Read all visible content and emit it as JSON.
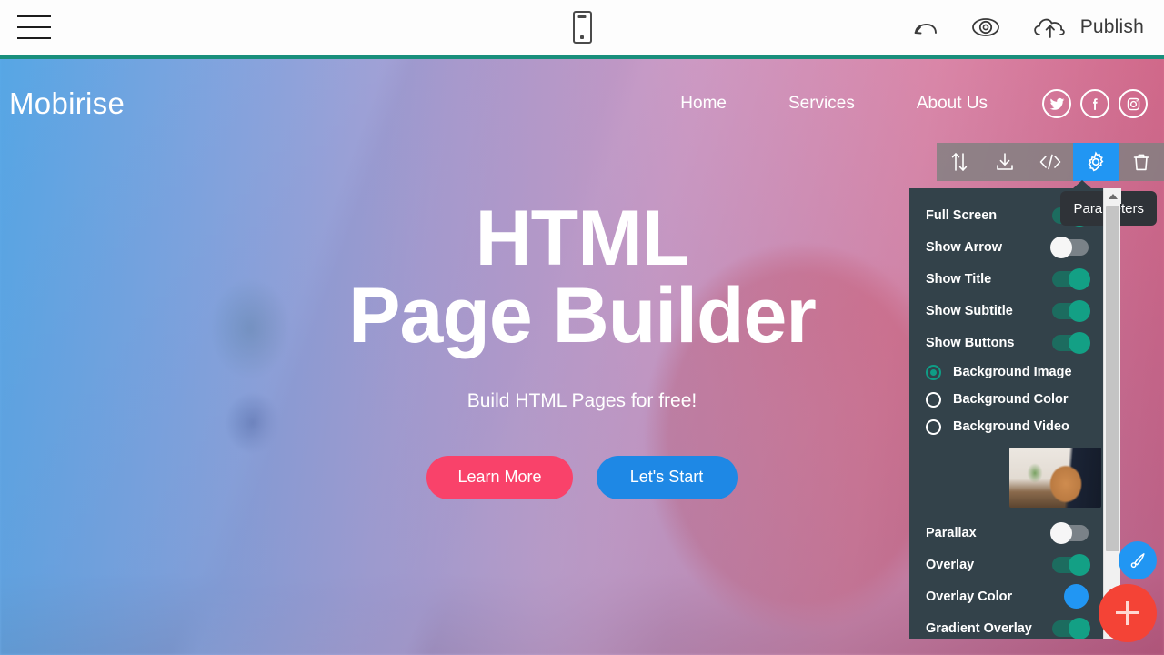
{
  "app_toolbar": {
    "menu_icon": "hamburger-menu-icon",
    "device_icon": "mobile-device-icon",
    "undo_icon": "undo-arrow-icon",
    "preview_icon": "eye-preview-icon",
    "publish_icon": "cloud-upload-icon",
    "publish_label": "Publish"
  },
  "site": {
    "brand": "Mobirise",
    "nav_links": [
      {
        "label": "Home"
      },
      {
        "label": "Services"
      },
      {
        "label": "About Us"
      }
    ],
    "social": [
      {
        "name": "twitter-icon"
      },
      {
        "name": "facebook-icon"
      },
      {
        "name": "instagram-icon"
      }
    ]
  },
  "hero": {
    "title_line1": "HTML",
    "title_line2": "Page Builder",
    "subtitle": "Build HTML Pages for free!",
    "buttons": [
      {
        "label": "Learn More",
        "color": "#f9426a"
      },
      {
        "label": "Let's Start",
        "color": "#1e88e5"
      }
    ]
  },
  "block_toolbar": {
    "items": [
      {
        "name": "move-block-icon",
        "active": false
      },
      {
        "name": "download-icon",
        "active": false
      },
      {
        "name": "code-editor-icon",
        "active": false
      },
      {
        "name": "gear-settings-icon",
        "active": true
      },
      {
        "name": "trash-delete-icon",
        "active": false
      }
    ],
    "active_color": "#2196f3"
  },
  "tooltip": {
    "text": "Parameters"
  },
  "settings_panel": {
    "toggles": [
      {
        "label": "Full Screen",
        "on": true
      },
      {
        "label": "Show Arrow",
        "on": false
      },
      {
        "label": "Show Title",
        "on": true
      },
      {
        "label": "Show Subtitle",
        "on": true
      },
      {
        "label": "Show Buttons",
        "on": true
      }
    ],
    "background_options": [
      {
        "label": "Background Image",
        "selected": true
      },
      {
        "label": "Background Color",
        "selected": false
      },
      {
        "label": "Background Video",
        "selected": false
      }
    ],
    "thumbnail_name": "background-image-thumbnail",
    "bottom_toggles": [
      {
        "label": "Parallax",
        "on": false
      },
      {
        "label": "Overlay",
        "on": true
      }
    ],
    "overlay_color_label": "Overlay Color",
    "overlay_color": "#2196f3",
    "gradient_overlay": {
      "label": "Gradient Overlay",
      "on": true
    },
    "toggle_on_color": "#13a085",
    "toggle_off_color": "#7a8288",
    "panel_bg": "#33424a"
  },
  "fabs": [
    {
      "name": "brush-style-icon",
      "color": "#2196f3"
    },
    {
      "name": "add-block-icon",
      "color": "#f44336"
    }
  ]
}
